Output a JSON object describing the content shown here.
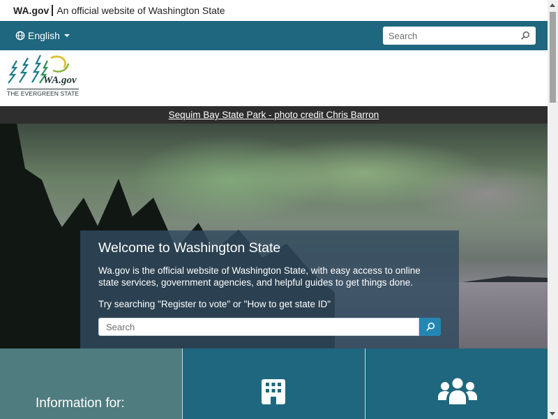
{
  "official_bar": {
    "brand": "WA.gov",
    "text": "An official website of Washington State"
  },
  "util_bar": {
    "language_label": "English",
    "search_placeholder": "Search"
  },
  "logo": {
    "wordmark": "WA.gov",
    "tagline": "THE EVERGREEN STATE"
  },
  "hero": {
    "photo_credit": "Sequim Bay State Park - photo credit Chris Barron",
    "title": "Welcome to Washington State",
    "description": "Wa.gov is the official website of Washington State, with easy access to online state services, government agencies, and helpful guides to get things done.",
    "try_text": "Try searching \"Register to vote\" or \"How to get state ID\"",
    "search_placeholder": "Search"
  },
  "tiles": {
    "info_label": "Information for:"
  },
  "colors": {
    "teal": "#1e677f",
    "info_tile": "#4f7c7e",
    "search_button": "#2486b3",
    "welcome_card": "#314b5f"
  },
  "icons": [
    "globe-icon",
    "caret-down-icon",
    "search-icon",
    "building-icon",
    "people-icon"
  ]
}
